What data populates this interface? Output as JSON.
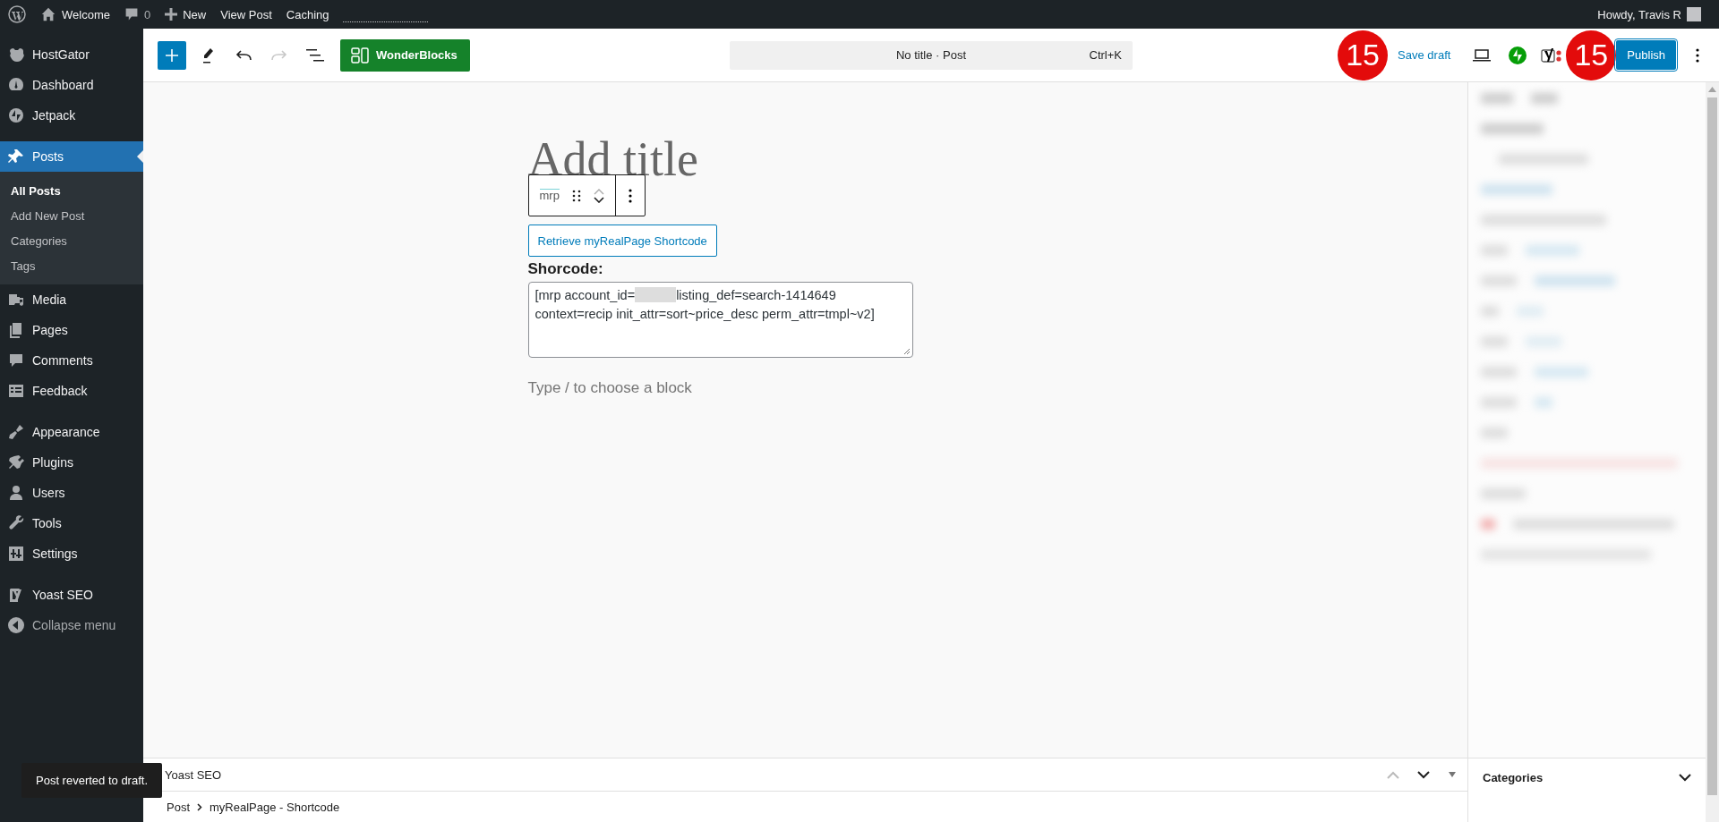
{
  "admin_bar": {
    "site": "Welcome",
    "comments": "0",
    "new": "New",
    "items": [
      "View Post",
      "Caching"
    ],
    "greeting": "Howdy, Travis R"
  },
  "sidebar": {
    "groups": [
      {
        "items": [
          {
            "label": "HostGator",
            "selected": false
          },
          {
            "label": "Dashboard",
            "selected": false
          },
          {
            "label": "Jetpack",
            "selected": false
          }
        ]
      },
      {
        "items": [
          {
            "label": "Posts",
            "selected": true,
            "children": [
              {
                "label": "All Posts",
                "selected": true
              },
              {
                "label": "Add New Post",
                "selected": false
              },
              {
                "label": "Categories",
                "selected": false
              },
              {
                "label": "Tags",
                "selected": false
              }
            ]
          },
          {
            "label": "Media",
            "selected": false
          },
          {
            "label": "Pages",
            "selected": false
          },
          {
            "label": "Comments",
            "selected": false
          },
          {
            "label": "Feedback",
            "selected": false
          }
        ]
      },
      {
        "items": [
          {
            "label": "Appearance",
            "selected": false
          },
          {
            "label": "Plugins",
            "selected": false
          },
          {
            "label": "Users",
            "selected": false
          },
          {
            "label": "Tools",
            "selected": false
          },
          {
            "label": "Settings",
            "selected": false
          }
        ]
      },
      {
        "items": [
          {
            "label": "Yoast SEO",
            "selected": false
          }
        ]
      }
    ],
    "collapse": "Collapse menu"
  },
  "header": {
    "undo": {
      "disabled": false
    },
    "redo": {
      "disabled": true
    },
    "tool_button": "WonderBlocks",
    "command": {
      "title": "No title · Post",
      "shortcut": "Ctrl+K"
    },
    "save": "Save draft",
    "publish": "Publish"
  },
  "annotations": [
    "15",
    "15"
  ],
  "editor": {
    "title_placeholder": "Add title",
    "block_label": "mrp",
    "button": "Retrieve myRealPage Shortcode",
    "field_label": "Shorcode:",
    "shortcode_before": "[mrp account_id=",
    "shortcode_after": "listing_def=search-1414649 context=recip init_attr=sort~price_desc perm_attr=tmpl~v2]",
    "appender": "Type / to choose a block"
  },
  "meta_box": {
    "title": "Yoast SEO"
  },
  "settings_panel": {
    "title": "Categories"
  },
  "breadcrumb": [
    "Post",
    "myRealPage - Shortcode"
  ],
  "notice": "Post reverted to draft."
}
